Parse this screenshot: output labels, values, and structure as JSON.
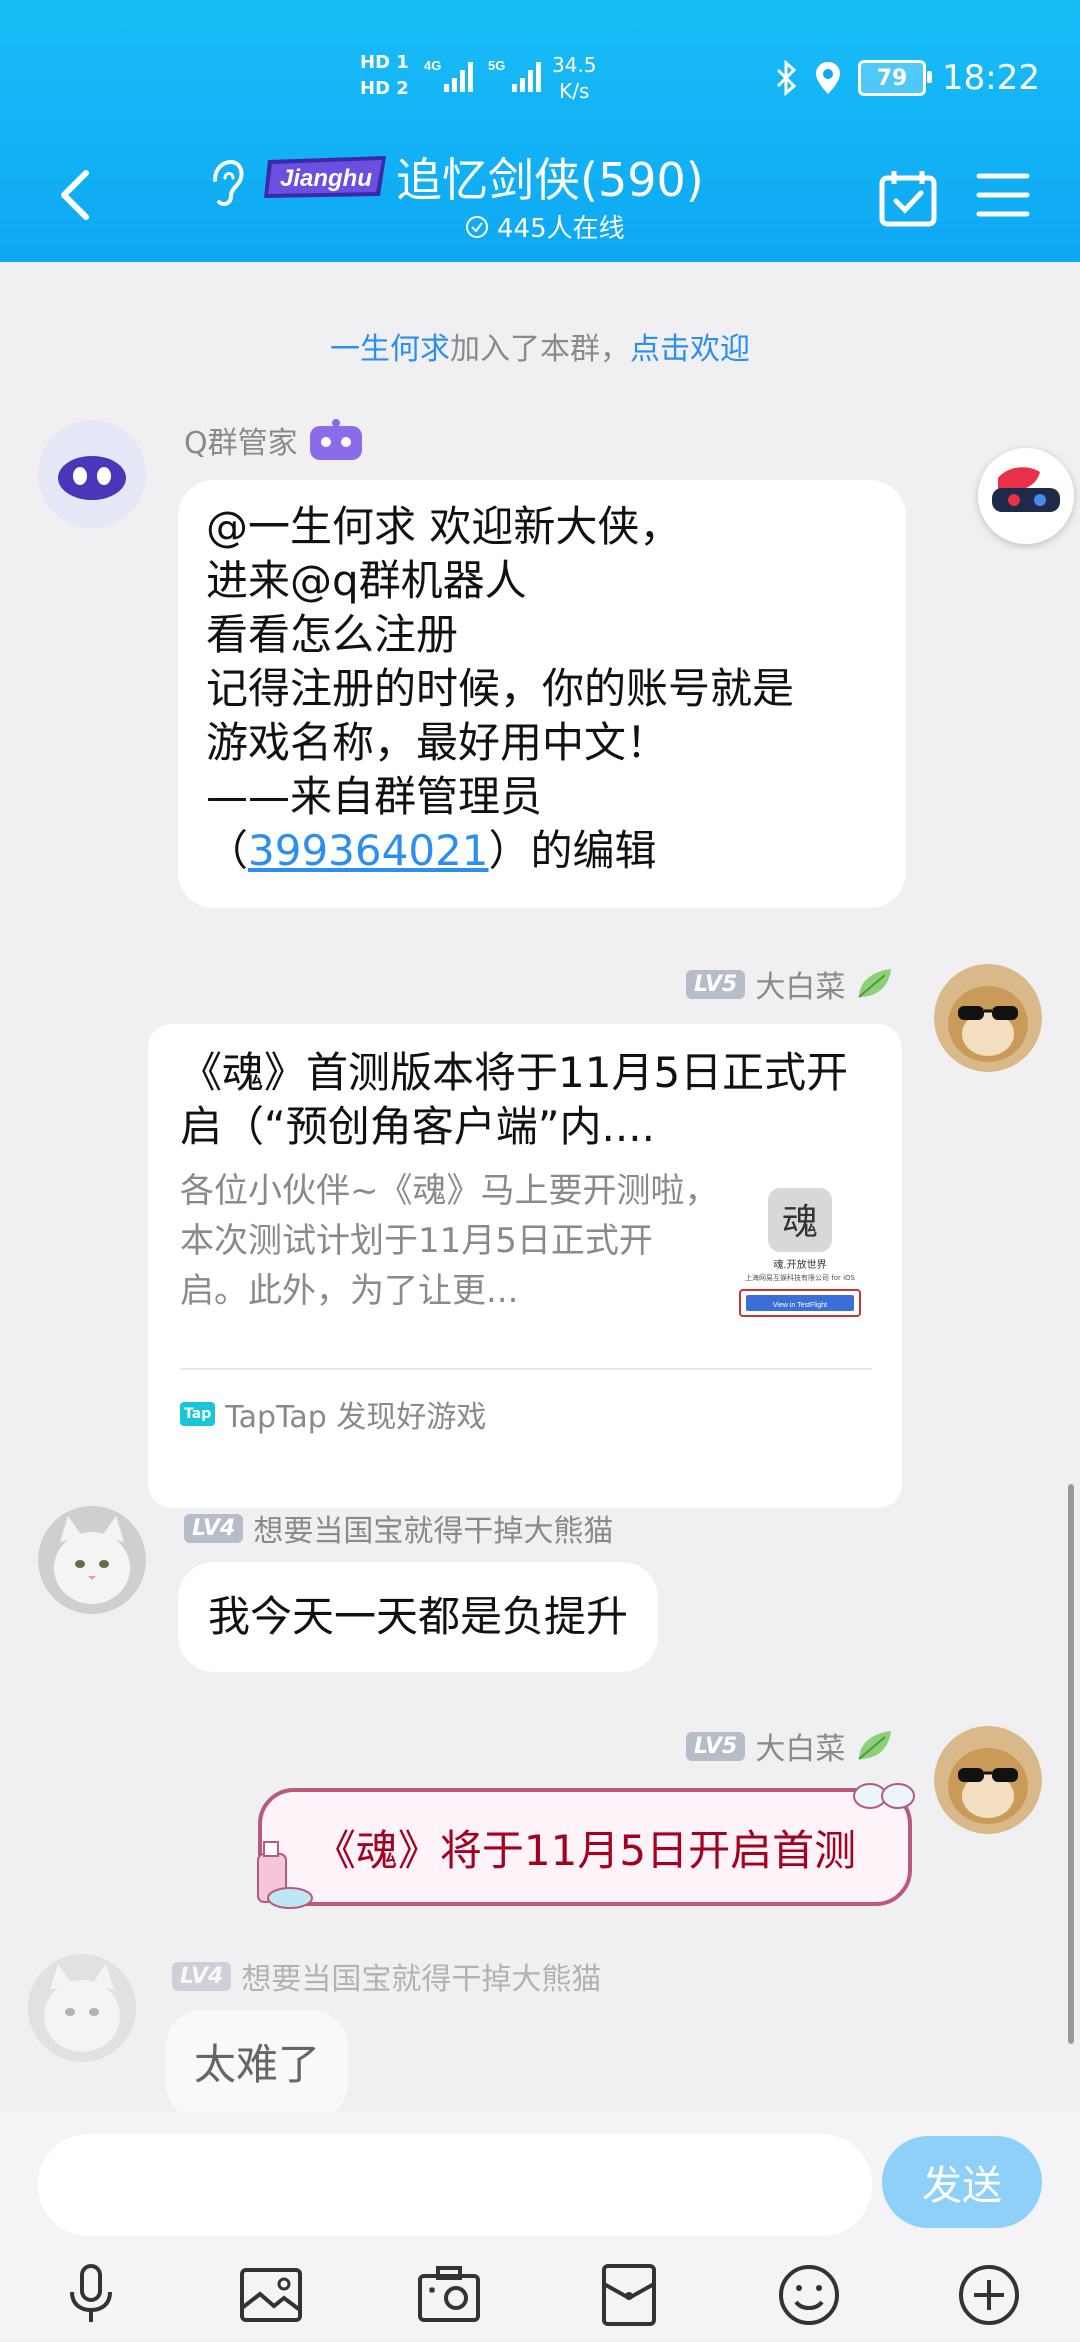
{
  "status_bar": {
    "sim1": "HD 1",
    "sim2": "HD 2",
    "net1": "4G",
    "net2": "5G",
    "speed_value": "34.5",
    "speed_unit": "K/s",
    "battery": "79",
    "time": "18:22"
  },
  "header": {
    "logo_text": "Jianghu",
    "title": "追忆剑侠(590)",
    "online": "445人在线"
  },
  "system_message": {
    "name": "一生何求",
    "text": "加入了本群，",
    "action": "点击欢迎"
  },
  "messages": {
    "bot": {
      "sender": "Q群管家",
      "lines": [
        "@一生何求 欢迎新大侠，",
        "进来@q群机器人",
        "看看怎么注册",
        "记得注册的时候，你的账号就是",
        "游戏名称，最好用中文！",
        "——来自群管理员"
      ],
      "last_prefix": "（",
      "last_link": "399364021",
      "last_suffix": "）的编辑"
    },
    "card": {
      "level": "LV5",
      "sender": "大白菜",
      "title": "《魂》首测版本将于11月5日正式开启（“预创角客户端”内....",
      "desc": "各位小伙伴~《魂》马上要开测啦，本次测试计划于11月5日正式开启。此外，为了让更...",
      "thumb_caption1": "魂.开放世界",
      "thumb_caption2": "上海网易互娱科技有限公司 for iOS",
      "thumb_button": "View in TestFlight",
      "source_badge": "Tap",
      "source": "TapTap 发现好游戏"
    },
    "panda1": {
      "level": "LV4",
      "sender": "想要当国宝就得干掉大熊猫",
      "text": "我今天一天都是负提升"
    },
    "special": {
      "level": "LV5",
      "sender": "大白菜",
      "text": "《魂》将于11月5日开启首测"
    },
    "panda2": {
      "level": "LV4",
      "sender": "想要当国宝就得干掉大熊猫",
      "text": "太难了"
    }
  },
  "input": {
    "placeholder": "",
    "send_label": "发送"
  },
  "toolbar": {
    "icons": [
      "microphone-icon",
      "image-icon",
      "camera-icon",
      "red-packet-icon",
      "emoji-icon",
      "plus-icon"
    ]
  },
  "colors": {
    "header": "#0ea8f3",
    "link": "#2b8ef0",
    "send_button": "#8fd0f8",
    "special_text": "#a4001f"
  }
}
